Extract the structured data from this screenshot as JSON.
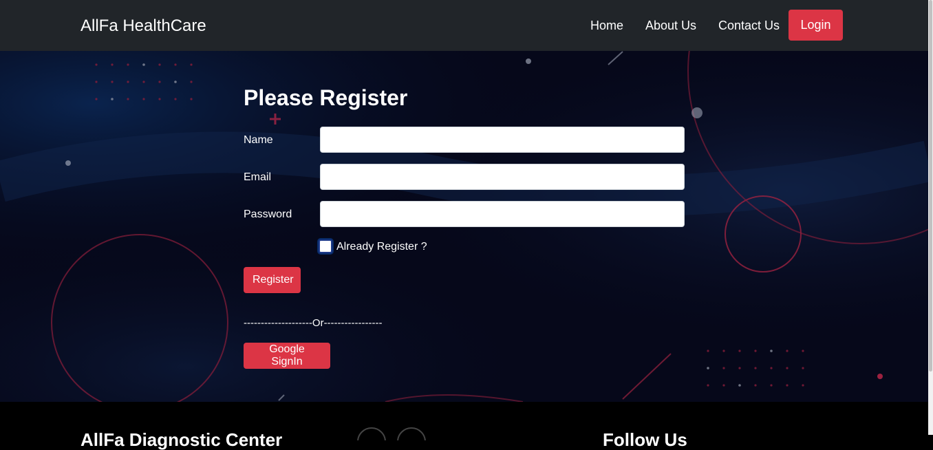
{
  "nav": {
    "brand": "AllFa HealthCare",
    "links": [
      "Home",
      "About Us",
      "Contact Us"
    ],
    "login_label": "Login"
  },
  "form": {
    "title": "Please Register",
    "name_label": "Name",
    "name_value": "",
    "email_label": "Email",
    "email_value": "",
    "password_label": "Password",
    "password_value": "",
    "checkbox_label": "Already Register ?",
    "checkbox_checked": false,
    "register_label": "Register",
    "divider_text": "--------------------Or-----------------",
    "google_label": "Google SignIn"
  },
  "footer": {
    "left_heading": "AllFa Diagnostic Center",
    "right_heading": "Follow Us"
  },
  "colors": {
    "navbar": "#212529",
    "accent": "#dc3545",
    "hero_background": "#06081a",
    "text": "#ffffff"
  }
}
